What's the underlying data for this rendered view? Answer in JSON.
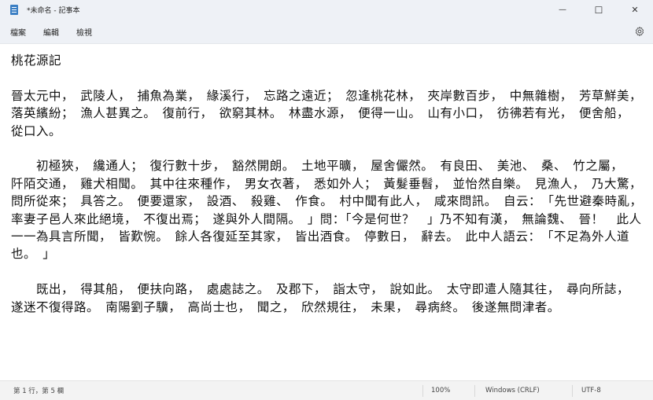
{
  "window": {
    "title": "*未命名 - 記事本",
    "minimize_glyph": "—",
    "maximize_glyph": "☐",
    "close_glyph": "✕"
  },
  "menu": {
    "file": "檔案",
    "edit": "編輯",
    "view": "檢視"
  },
  "icons": {
    "app": "notepad-icon",
    "settings": "gear-icon"
  },
  "editor": {
    "content": "桃花源記\n\n晉太元中，　武陵人，　捕魚為業，　緣溪行，　忘路之遠近；　忽逢桃花林，　夾岸數百步，　中無雜樹，　芳草鮮美，　落英繽紛；　漁人甚異之。　復前行，　欲窮其林。　林盡水源，　便得一山。　山有小口，　彷彿若有光，　便舍船，　從口入。\n\n　　初極狹，　纔通人；　復行數十步，　豁然開朗。　土地平曠，　屋舍儼然。　有良田、　美池、　桑、　竹之屬，　阡陌交通，　雞犬相聞。　其中往來種作，　男女衣著，　悉如外人；　黃髮垂髫，　並怡然自樂。　見漁人，　乃大驚，　問所從來；　具答之。　便要還家，　設酒、　殺雞、　作食。　村中聞有此人，　咸來問訊。　自云：　「先世避秦時亂，　率妻子邑人來此絕境，　不復出焉；　遂與外人間隔。　」問：「今是何世？　」乃不知有漢，　無論魏、　晉！　此人一一為具言所聞，　皆歎惋。　餘人各復延至其家，　皆出酒食。　停數日，　辭去。　此中人語云：　「不足為外人道也。　」\n\n　　既出，　得其船，　便扶向路，　處處誌之。　及郡下，　詣太守，　說如此。　太守即遣人隨其往，　尋向所誌，　遂迷不復得路。　南陽劉子驥，　高尚士也，　聞之，　欣然規往，　未果，　尋病終。　後遂無問津者。"
  },
  "status": {
    "position": "第 1 行，第 5 欄",
    "zoom": "100%",
    "line_ending": "Windows (CRLF)",
    "encoding": "UTF-8"
  }
}
